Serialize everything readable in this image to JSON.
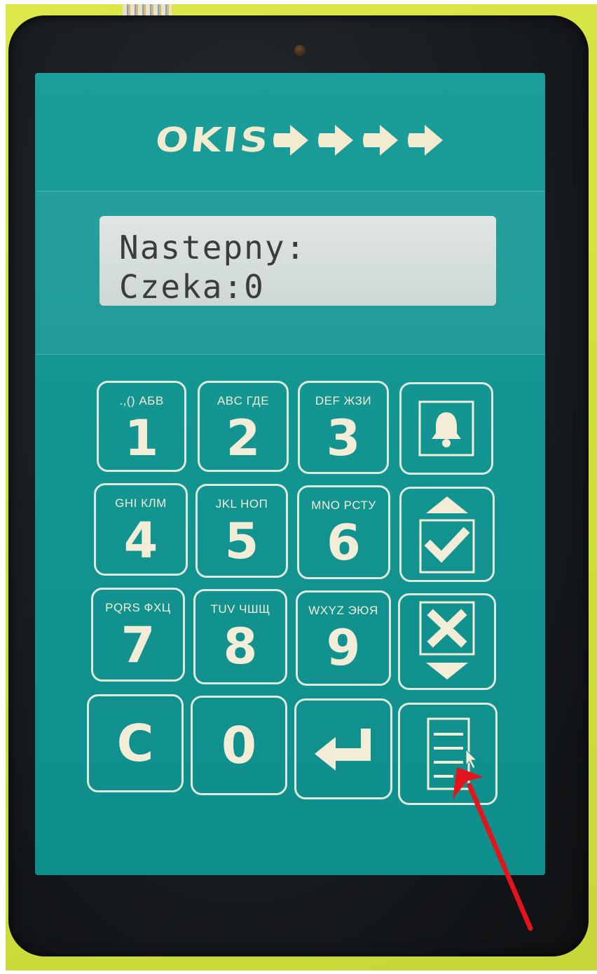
{
  "brand": {
    "logo_text": "OKIS"
  },
  "display": {
    "line1": "Nastepny:",
    "line2": "Czeka:0"
  },
  "keypad": {
    "keys": [
      {
        "sub": ".,() АБВ",
        "main": "1"
      },
      {
        "sub": "ABC ГДЕ",
        "main": "2"
      },
      {
        "sub": "DEF ЖЗИ",
        "main": "3"
      },
      {
        "sub": "GHI КЛМ",
        "main": "4"
      },
      {
        "sub": "JKL НОП",
        "main": "5"
      },
      {
        "sub": "MNO РСТУ",
        "main": "6"
      },
      {
        "sub": "PQRS ФХЦ",
        "main": "7"
      },
      {
        "sub": "TUV ЧШЩ",
        "main": "8"
      },
      {
        "sub": "WXYZ ЭЮЯ",
        "main": "9"
      },
      {
        "main": "C"
      },
      {
        "main": "0"
      }
    ],
    "function_keys": [
      "bell-icon",
      "up-check-icon",
      "x-down-icon",
      "enter-icon",
      "menu-list-icon"
    ]
  },
  "colors": {
    "panel": "#139592",
    "key_text": "#f3ecd6",
    "lcd_bg": "#d7dfdd",
    "annotation_arrow": "#e3141b"
  }
}
